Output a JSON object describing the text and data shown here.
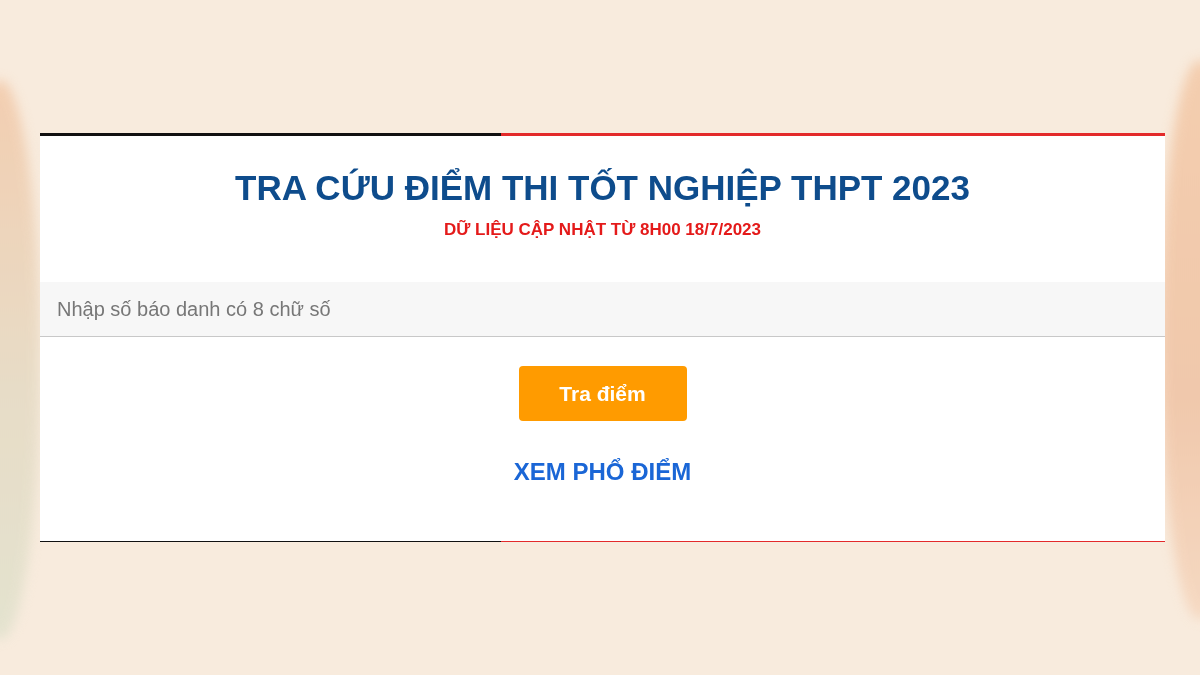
{
  "title": "TRA CỨU ĐIỂM THI TỐT NGHIỆP THPT 2023",
  "subtitle": "DỮ LIỆU CẬP NHẬT TỪ 8H00 18/7/2023",
  "search": {
    "placeholder": "Nhập số báo danh có 8 chữ số"
  },
  "submit_button": "Tra điểm",
  "link": "XEM PHỔ ĐIỂM"
}
